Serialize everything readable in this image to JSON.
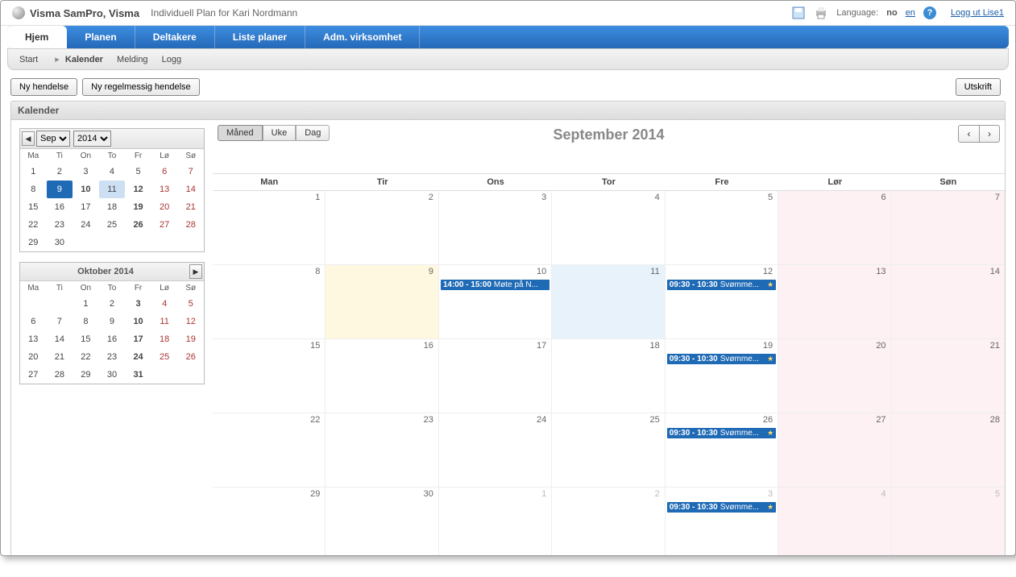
{
  "header": {
    "app_title": "Visma SamPro, Visma",
    "subtitle": "Individuell Plan for Kari Nordmann",
    "language_label": "Language:",
    "lang_no": "no",
    "lang_en": "en",
    "logout": "Logg ut Lise1"
  },
  "nav": {
    "tabs": [
      "Hjem",
      "Planen",
      "Deltakere",
      "Liste planer",
      "Adm. virksomhet"
    ],
    "active": 0
  },
  "subnav": {
    "start": "Start",
    "kalender": "Kalender",
    "melding": "Melding",
    "logg": "Logg"
  },
  "toolbar": {
    "new_event": "Ny hendelse",
    "new_recurring": "Ny regelmessig hendelse",
    "print": "Utskrift"
  },
  "section_title": "Kalender",
  "view": {
    "month": "Måned",
    "week": "Uke",
    "day": "Dag",
    "active": "month"
  },
  "calendar": {
    "title": "September 2014",
    "day_headers": [
      "Man",
      "Tir",
      "Ons",
      "Tor",
      "Fre",
      "Lør",
      "Søn"
    ],
    "weeks": [
      [
        {
          "n": "1"
        },
        {
          "n": "2"
        },
        {
          "n": "3"
        },
        {
          "n": "4"
        },
        {
          "n": "5"
        },
        {
          "n": "6",
          "we": true
        },
        {
          "n": "7",
          "we": true
        }
      ],
      [
        {
          "n": "8"
        },
        {
          "n": "9",
          "today": true
        },
        {
          "n": "10",
          "events": [
            {
              "time": "14:00 - 15:00",
              "title": "Møte på N..."
            }
          ]
        },
        {
          "n": "11",
          "hl": true
        },
        {
          "n": "12",
          "events": [
            {
              "time": "09:30 - 10:30",
              "title": "Svømme...",
              "star": true
            }
          ]
        },
        {
          "n": "13",
          "we": true
        },
        {
          "n": "14",
          "we": true
        }
      ],
      [
        {
          "n": "15"
        },
        {
          "n": "16"
        },
        {
          "n": "17"
        },
        {
          "n": "18"
        },
        {
          "n": "19",
          "events": [
            {
              "time": "09:30 - 10:30",
              "title": "Svømme...",
              "star": true
            }
          ]
        },
        {
          "n": "20",
          "we": true
        },
        {
          "n": "21",
          "we": true
        }
      ],
      [
        {
          "n": "22"
        },
        {
          "n": "23"
        },
        {
          "n": "24"
        },
        {
          "n": "25"
        },
        {
          "n": "26",
          "events": [
            {
              "time": "09:30 - 10:30",
              "title": "Svømme...",
              "star": true
            }
          ]
        },
        {
          "n": "27",
          "we": true
        },
        {
          "n": "28",
          "we": true
        }
      ],
      [
        {
          "n": "29"
        },
        {
          "n": "30"
        },
        {
          "n": "1",
          "other": true
        },
        {
          "n": "2",
          "other": true
        },
        {
          "n": "3",
          "other": true,
          "events": [
            {
              "time": "09:30 - 10:30",
              "title": "Svømme...",
              "star": true
            }
          ]
        },
        {
          "n": "4",
          "other": true,
          "we": true
        },
        {
          "n": "5",
          "other": true,
          "we": true
        }
      ]
    ]
  },
  "mini1": {
    "month": "Sep",
    "year": "2014",
    "hdrs": [
      "Ma",
      "Ti",
      "On",
      "To",
      "Fr",
      "Lø",
      "Sø"
    ],
    "rows": [
      [
        {
          "n": "1"
        },
        {
          "n": "2"
        },
        {
          "n": "3"
        },
        {
          "n": "4"
        },
        {
          "n": "5"
        },
        {
          "n": "6",
          "we": true
        },
        {
          "n": "7",
          "we": true
        }
      ],
      [
        {
          "n": "8"
        },
        {
          "n": "9",
          "sel": true
        },
        {
          "n": "10",
          "bold": true
        },
        {
          "n": "11",
          "hl": true
        },
        {
          "n": "12",
          "bold": true
        },
        {
          "n": "13",
          "we": true
        },
        {
          "n": "14",
          "we": true
        }
      ],
      [
        {
          "n": "15"
        },
        {
          "n": "16"
        },
        {
          "n": "17"
        },
        {
          "n": "18"
        },
        {
          "n": "19",
          "bold": true
        },
        {
          "n": "20",
          "we": true
        },
        {
          "n": "21",
          "we": true
        }
      ],
      [
        {
          "n": "22"
        },
        {
          "n": "23"
        },
        {
          "n": "24"
        },
        {
          "n": "25"
        },
        {
          "n": "26",
          "bold": true
        },
        {
          "n": "27",
          "we": true
        },
        {
          "n": "28",
          "we": true
        }
      ],
      [
        {
          "n": "29"
        },
        {
          "n": "30"
        },
        {
          "n": ""
        },
        {
          "n": ""
        },
        {
          "n": ""
        },
        {
          "n": ""
        },
        {
          "n": ""
        }
      ]
    ]
  },
  "mini2": {
    "title": "Oktober 2014",
    "hdrs": [
      "Ma",
      "Ti",
      "On",
      "To",
      "Fr",
      "Lø",
      "Sø"
    ],
    "rows": [
      [
        {
          "n": ""
        },
        {
          "n": ""
        },
        {
          "n": "1"
        },
        {
          "n": "2"
        },
        {
          "n": "3",
          "bold": true
        },
        {
          "n": "4",
          "we": true
        },
        {
          "n": "5",
          "we": true
        }
      ],
      [
        {
          "n": "6"
        },
        {
          "n": "7"
        },
        {
          "n": "8"
        },
        {
          "n": "9"
        },
        {
          "n": "10",
          "bold": true
        },
        {
          "n": "11",
          "we": true
        },
        {
          "n": "12",
          "we": true
        }
      ],
      [
        {
          "n": "13"
        },
        {
          "n": "14"
        },
        {
          "n": "15"
        },
        {
          "n": "16"
        },
        {
          "n": "17",
          "bold": true
        },
        {
          "n": "18",
          "we": true
        },
        {
          "n": "19",
          "we": true
        }
      ],
      [
        {
          "n": "20"
        },
        {
          "n": "21"
        },
        {
          "n": "22"
        },
        {
          "n": "23"
        },
        {
          "n": "24",
          "bold": true
        },
        {
          "n": "25",
          "we": true
        },
        {
          "n": "26",
          "we": true
        }
      ],
      [
        {
          "n": "27"
        },
        {
          "n": "28"
        },
        {
          "n": "29"
        },
        {
          "n": "30"
        },
        {
          "n": "31",
          "bold": true
        },
        {
          "n": ""
        },
        {
          "n": ""
        }
      ]
    ]
  }
}
